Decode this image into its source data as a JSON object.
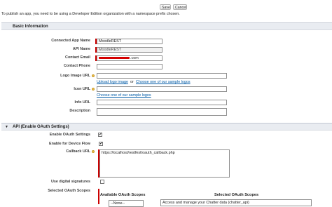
{
  "toolbar": {
    "save_label": "Save",
    "cancel_label": "Cancel"
  },
  "notice": "To publish an app, you need to be using a Developer Edition organization with a namespace prefix chosen.",
  "basic_info": {
    "title": "Basic Information",
    "connected_app_name_label": "Connected App Name",
    "connected_app_name_value": "MoodleREST",
    "api_name_label": "API Name",
    "api_name_value": "MoodleREST",
    "contact_email_label": "Contact Email",
    "contact_email_value": ".com",
    "contact_phone_label": "Contact Phone",
    "contact_phone_value": "",
    "logo_image_url_label": "Logo Image URL",
    "logo_image_url_value": "",
    "upload_logo_link": "Upload logo image",
    "or_text": "or",
    "choose_sample_logos_link": "Choose one of our sample logos",
    "icon_url_label": "Icon URL",
    "icon_url_value": "",
    "choose_sample_logos_link_2": "Choose one of our sample logos",
    "info_url_label": "Info URL",
    "info_url_value": "",
    "description_label": "Description",
    "description_value": ""
  },
  "api_section": {
    "title": "API (Enable OAuth Settings)",
    "enable_oauth_label": "Enable OAuth Settings",
    "enable_oauth_checked": true,
    "device_flow_label": "Enable for Device Flow",
    "device_flow_checked": true,
    "callback_url_label": "Callback URL",
    "callback_url_value": "https://localhost/restfest/oauth_callback.php",
    "digital_signatures_label": "Use digital signatures",
    "digital_signatures_checked": false,
    "selected_scopes_label": "Selected OAuth Scopes",
    "available_scopes_header": "Available OAuth Scopes",
    "selected_scopes_header": "Selected OAuth Scopes",
    "available_first_option": "--None--",
    "selected_first_option": "Access and manage your Chatter data (chatter_api)"
  }
}
